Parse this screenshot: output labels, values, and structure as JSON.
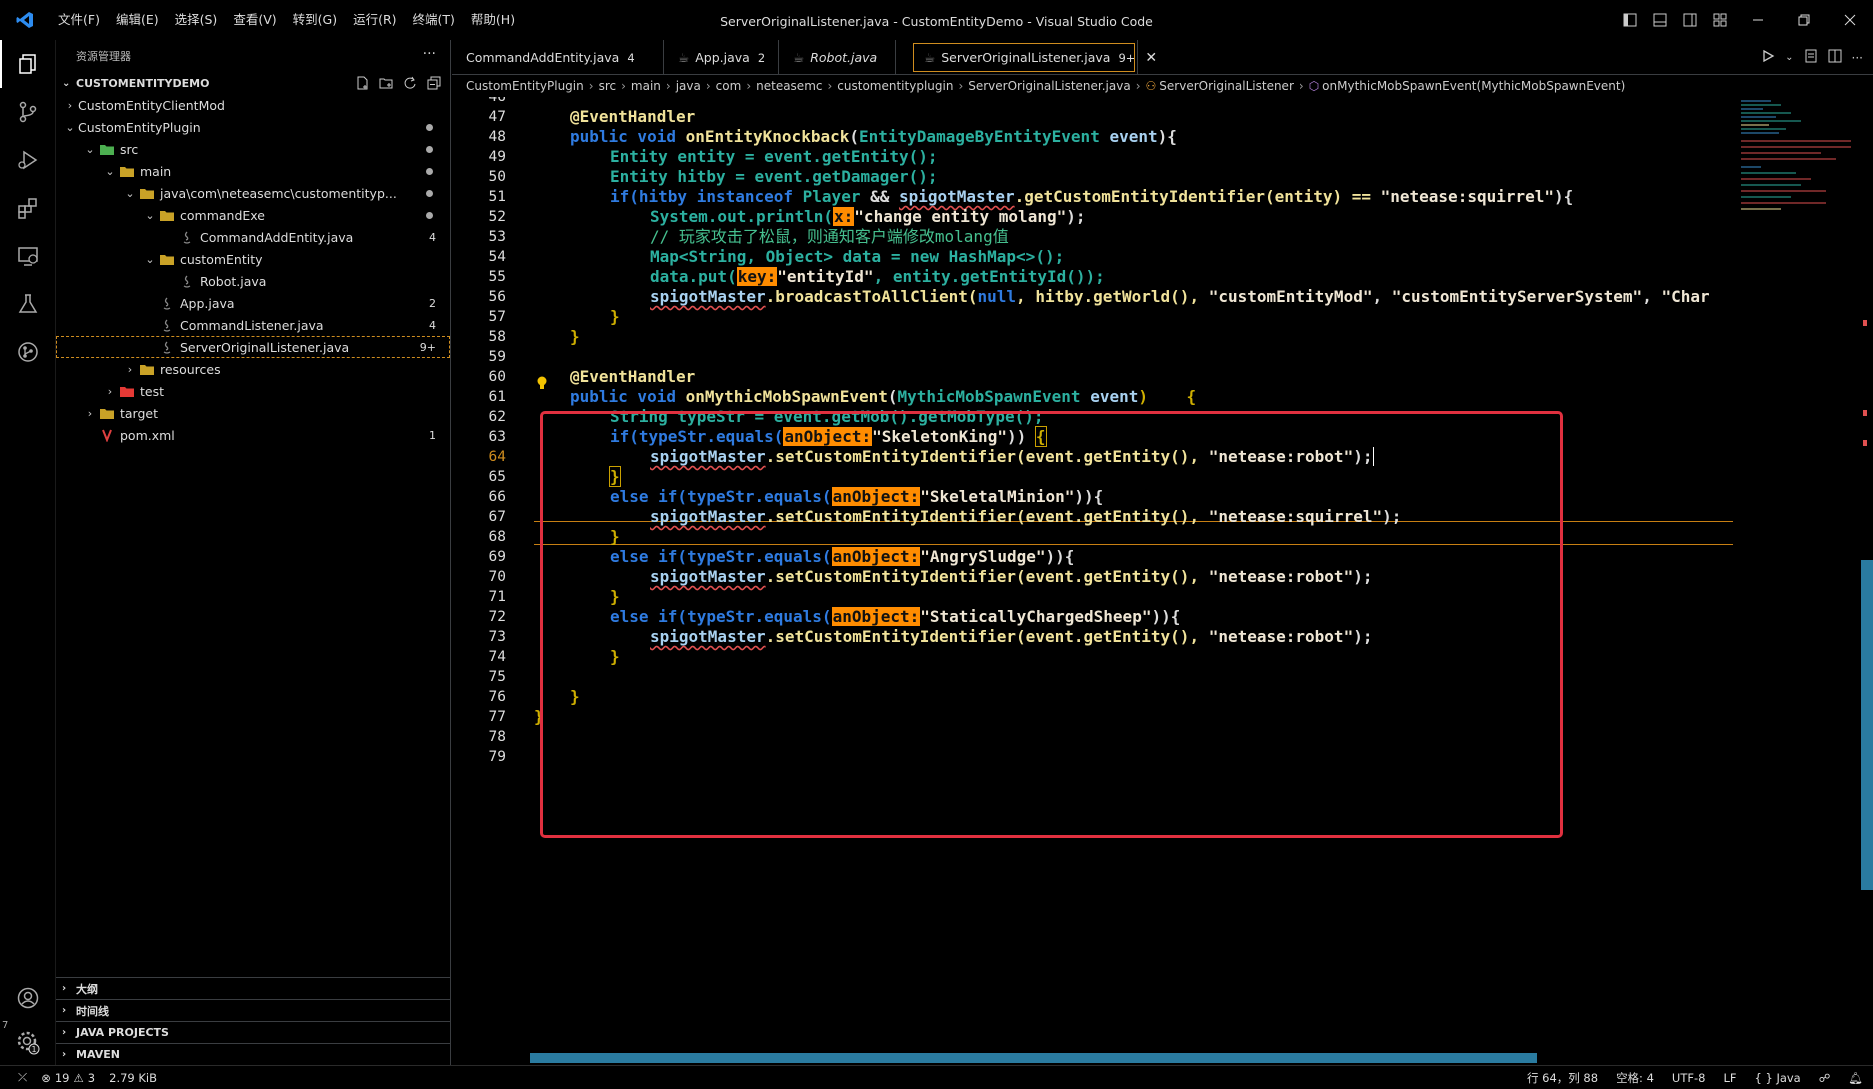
{
  "titlebar": {
    "menu": [
      "文件(F)",
      "编辑(E)",
      "选择(S)",
      "查看(V)",
      "转到(G)",
      "运行(R)",
      "终端(T)",
      "帮助(H)"
    ],
    "title": "ServerOriginalListener.java - CustomEntityDemo - Visual Studio Code"
  },
  "sidebar": {
    "header": "资源管理器",
    "more": "···",
    "project": "CUSTOMENTITYDEMO",
    "tree": [
      {
        "label": "CustomEntityClientMod",
        "depth": 0,
        "chev": "›",
        "icon": "none",
        "badge": ""
      },
      {
        "label": "CustomEntityPlugin",
        "depth": 0,
        "chev": "⌄",
        "icon": "none",
        "badge": "dot"
      },
      {
        "label": "src",
        "depth": 1,
        "chev": "⌄",
        "icon": "folder-src",
        "badge": "dot"
      },
      {
        "label": "main",
        "depth": 2,
        "chev": "⌄",
        "icon": "folder",
        "badge": "dot"
      },
      {
        "label": "java\\com\\neteasemc\\customentityp...",
        "depth": 3,
        "chev": "⌄",
        "icon": "folder",
        "badge": "dot"
      },
      {
        "label": "commandExe",
        "depth": 4,
        "chev": "⌄",
        "icon": "folder",
        "badge": "dot"
      },
      {
        "label": "CommandAddEntity.java",
        "depth": 5,
        "chev": "",
        "icon": "java",
        "badge": "4"
      },
      {
        "label": "customEntity",
        "depth": 4,
        "chev": "⌄",
        "icon": "folder",
        "badge": ""
      },
      {
        "label": "Robot.java",
        "depth": 5,
        "chev": "",
        "icon": "java",
        "badge": ""
      },
      {
        "label": "App.java",
        "depth": 4,
        "chev": "",
        "icon": "java",
        "badge": "2"
      },
      {
        "label": "CommandListener.java",
        "depth": 4,
        "chev": "",
        "icon": "java",
        "badge": "4"
      },
      {
        "label": "ServerOriginalListener.java",
        "depth": 4,
        "chev": "",
        "icon": "java",
        "badge": "9+",
        "selected": true
      },
      {
        "label": "resources",
        "depth": 3,
        "chev": "›",
        "icon": "folder",
        "badge": ""
      },
      {
        "label": "test",
        "depth": 2,
        "chev": "›",
        "icon": "folder-test",
        "badge": ""
      },
      {
        "label": "target",
        "depth": 1,
        "chev": "›",
        "icon": "folder",
        "badge": ""
      },
      {
        "label": "pom.xml",
        "depth": 1,
        "chev": "",
        "icon": "maven",
        "badge": "1"
      }
    ],
    "sections": [
      "大纲",
      "时间线",
      "JAVA PROJECTS",
      "MAVEN"
    ]
  },
  "tabs": [
    {
      "label": "CommandAddEntity.java",
      "num": "4"
    },
    {
      "label": "App.java",
      "num": "2"
    },
    {
      "label": "Robot.java",
      "num": ""
    },
    {
      "label": "ServerOriginalListener.java",
      "num": "9+"
    }
  ],
  "breadcrumb": [
    "CustomEntityPlugin",
    "src",
    "main",
    "java",
    "com",
    "neteasemc",
    "customentityplugin",
    "ServerOriginalListener.java",
    "ServerOriginalListener",
    "onMythicMobSpawnEvent(MythicMobSpawnEvent)"
  ],
  "editor": {
    "line_numbers": [
      "46",
      "47",
      "48",
      "49",
      "50",
      "51",
      "52",
      "53",
      "54",
      "55",
      "56",
      "57",
      "58",
      "59",
      "60",
      "61",
      "62",
      "63",
      "64",
      "65",
      "66",
      "67",
      "68",
      "69",
      "70",
      "71",
      "72",
      "73",
      "74",
      "75",
      "76",
      "77",
      "78",
      "79"
    ],
    "current_line": "64",
    "code": {
      "l47_a": "@EventHandler",
      "l48_k": "public void ",
      "l48_f": "onEntityKnockback",
      "l48_t": "EntityDamageByEntityEvent ",
      "l48_v": "event",
      "l48_e": "){",
      "l49": "Entity entity = event.getEntity();",
      "l50": "Entity hitby = event.getDamager();",
      "l51_a": "if(hitby instanceof ",
      "l51_b": "Player",
      "l51_c": " && ",
      "l51_d": "spigotMaster",
      "l51_e": ".getCustomEntityIdentifier(entity) == ",
      "l51_s": "\"netease:squirrel\"",
      "l51_f": "){",
      "l52_a": "System.out.println(",
      "l52_h": "x:",
      "l52_s": "\"change entity molang\"",
      "l52_e": ");",
      "l53": "// 玩家攻击了松鼠，则通知客户端修改molang值",
      "l54": "Map<String, Object> data = new HashMap<>();",
      "l55_a": "data.put(",
      "l55_h": "key:",
      "l55_s": "\"entityId\"",
      "l55_e": ", entity.getEntityId());",
      "l56_d": "spigotMaster",
      "l56_a": ".broadcastToAllClient(",
      "l56_n": "null",
      "l56_b": ", hitby.getWorld(), ",
      "l56_s1": "\"customEntityMod\"",
      "l56_c": ", ",
      "l56_s2": "\"customEntityServerSystem\"",
      "l56_d2": ", ",
      "l56_s3": "\"Char",
      "l57": "}",
      "l58": "}",
      "l60_a": "@EventHandler",
      "l61_k": "public void ",
      "l61_f": "onMythicMobSpawnEvent",
      "l61_t": "MythicMobSpawnEvent ",
      "l61_v": "event",
      "l61_e": ")    {",
      "l62": "String typeStr = event.getMob().getMobType();",
      "l63_a": "if(typeStr.equals(",
      "l63_h": "anObject:",
      "l63_s": "\"SkeletonKing\"",
      "l63_e": ")) ",
      "l63_b": "{",
      "l64_d": "spigotMaster",
      "l64_a": ".setCustomEntityIdentifier(event.getEntity(), ",
      "l64_s": "\"netease:robot\"",
      "l64_e": ");",
      "l65": "}",
      "l66_a": "else if(typeStr.equals(",
      "l66_h": "anObject:",
      "l66_s": "\"SkeletalMinion\"",
      "l66_e": ")){",
      "l67_d": "spigotMaster",
      "l67_a": ".setCustomEntityIdentifier(event.getEntity(), ",
      "l67_s": "\"netease:squirrel\"",
      "l67_e": ");",
      "l68": "}",
      "l69_a": "else if(typeStr.equals(",
      "l69_h": "anObject:",
      "l69_s": "\"AngrySludge\"",
      "l69_e": ")){",
      "l70_d": "spigotMaster",
      "l70_a": ".setCustomEntityIdentifier(event.getEntity(), ",
      "l70_s": "\"netease:robot\"",
      "l70_e": ");",
      "l71": "}",
      "l72_a": "else if(typeStr.equals(",
      "l72_h": "anObject:",
      "l72_s": "\"StaticallyChargedSheep\"",
      "l72_e": ")){",
      "l73_d": "spigotMaster",
      "l73_a": ".setCustomEntityIdentifier(event.getEntity(), ",
      "l73_s": "\"netease:robot\"",
      "l73_e": ");",
      "l74": "}",
      "l76": "}",
      "l77": "}"
    }
  },
  "statusbar": {
    "errors": "19",
    "warnings": "3",
    "size": "2.79 KiB",
    "position": "行 64，列 88",
    "spaces": "空格: 4",
    "encoding": "UTF-8",
    "eol": "LF",
    "language": "Java",
    "left_margin_digit": "7"
  },
  "colors": {
    "accent_orange": "#cf8d1f",
    "highlight_box": "#e0303f",
    "hint_bg": "#ff8c00"
  }
}
